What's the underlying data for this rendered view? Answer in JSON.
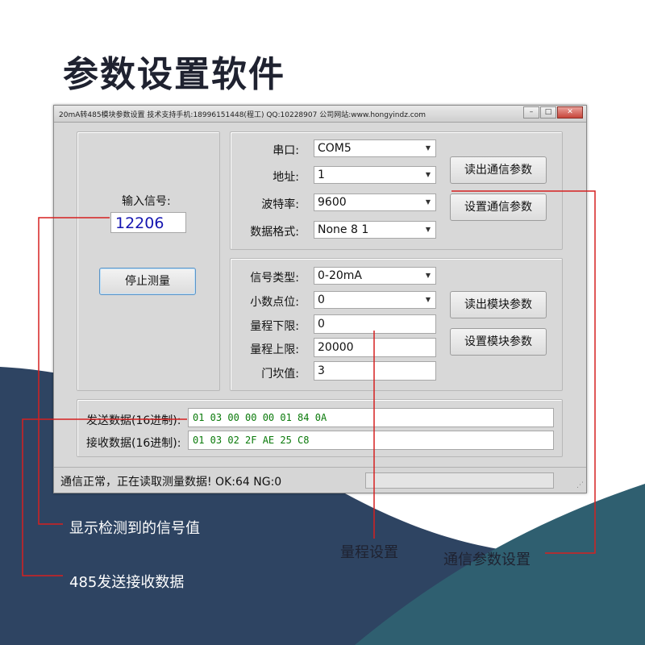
{
  "page_title": "参数设置软件",
  "window": {
    "title": "20mA转485模块参数设置    技术支持手机:18996151448(程工)  QQ:10228907   公司网站:www.hongyindz.com",
    "buttons": {
      "minimize": "–",
      "maximize": "□",
      "close": "✕"
    }
  },
  "left_panel": {
    "input_signal_label": "输入信号:",
    "input_signal_value": "12206",
    "stop_button": "停止测量"
  },
  "comm_panel": {
    "port_label": "串口:",
    "port_value": "COM5",
    "address_label": "地址:",
    "address_value": "1",
    "baud_label": "波特率:",
    "baud_value": "9600",
    "format_label": "数据格式:",
    "format_value": "None 8 1",
    "read_button": "读出通信参数",
    "set_button": "设置通信参数"
  },
  "module_panel": {
    "signal_type_label": "信号类型:",
    "signal_type_value": "0-20mA",
    "decimal_label": "小数点位:",
    "decimal_value": "0",
    "range_low_label": "量程下限:",
    "range_low_value": "0",
    "range_high_label": "量程上限:",
    "range_high_value": "20000",
    "threshold_label": "门坎值:",
    "threshold_value": "3",
    "read_button": "读出模块参数",
    "set_button": "设置模块参数"
  },
  "data_panel": {
    "send_label": "发送数据(16进制):",
    "send_value": "01 03 00 00 00 01 84 0A",
    "recv_label": "接收数据(16进制):",
    "recv_value": "01 03 02 2F AE 25 C8"
  },
  "status": {
    "text": "通信正常，正在读取测量数据!  OK:64  NG:0"
  },
  "callouts": {
    "signal_value": "显示检测到的信号值",
    "range_setting": "量程设置",
    "comm_setting": "通信参数设置",
    "rs485_data": "485发送接收数据"
  },
  "colors": {
    "accent_red": "#d62020",
    "wave_dark": "#2e4462",
    "wave_teal": "#2f5f70",
    "signal_blue": "#1515b0",
    "hex_green": "#0a7a0a"
  }
}
